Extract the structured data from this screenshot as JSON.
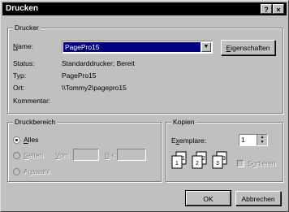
{
  "window": {
    "title": "Drucken",
    "help_btn": "?",
    "close_btn": "×"
  },
  "printer": {
    "group_label": "Drucker",
    "name_label": "Name:",
    "name_value": "PagePro15",
    "properties_button": "Eigenschaften",
    "status_label": "Status:",
    "status_value": "Standarddrucker; Bereit",
    "type_label": "Typ:",
    "type_value": "PagePro15",
    "location_label": "Ort:",
    "location_value": "\\\\Tommy2\\pagepro15",
    "comment_label": "Kommentar:"
  },
  "range": {
    "group_label": "Druckbereich",
    "all_label": "Alles",
    "pages_label": "Seiten",
    "from_label": "Von:",
    "to_label": "Bis:",
    "selection_label": "Auswahl"
  },
  "copies": {
    "group_label": "Kopien",
    "count_label": "Exemplare:",
    "count_value": "1",
    "collate_label": "Sortieren",
    "stack_labels": [
      "1",
      "1",
      "2",
      "2",
      "3",
      "3"
    ]
  },
  "buttons": {
    "ok": "OK",
    "cancel": "Abbrechen"
  }
}
